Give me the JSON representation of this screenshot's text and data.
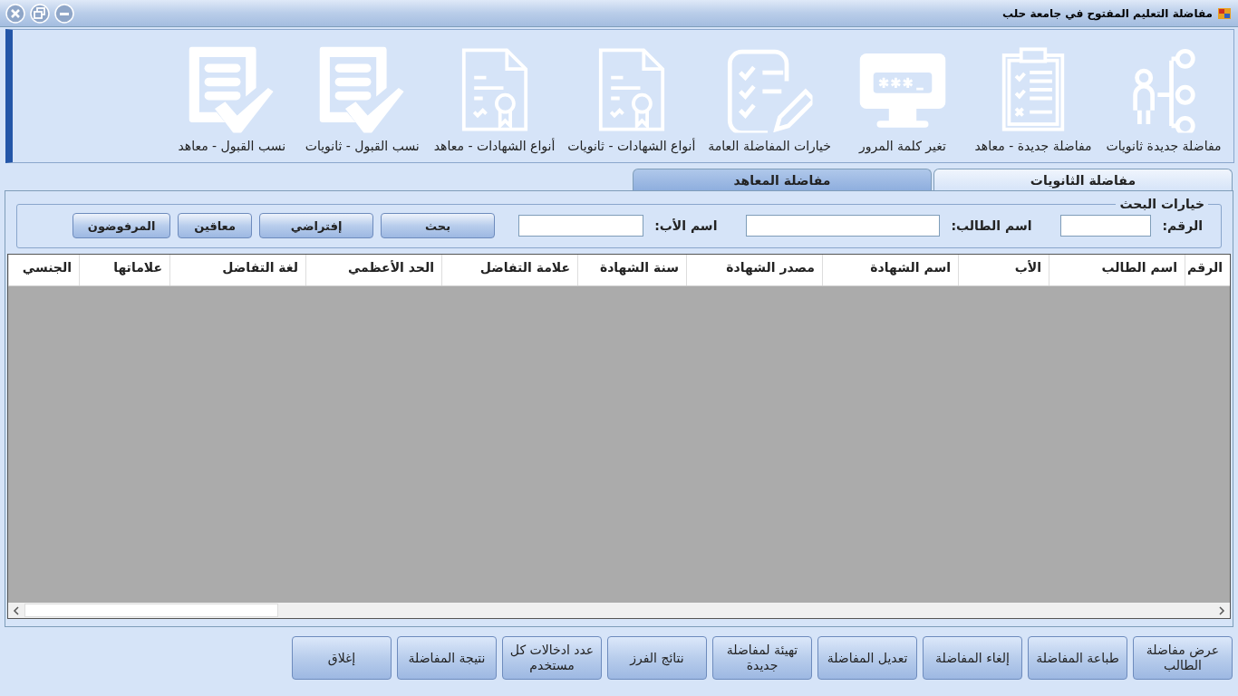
{
  "window": {
    "title": "مفاضلة التعليم المفتوح في جامعة حلب"
  },
  "toolbar": {
    "items": [
      {
        "label": "مفاضلة جديدة ثانويات"
      },
      {
        "label": "مفاضلة جديدة - معاهد"
      },
      {
        "label": "تغير كلمة المرور"
      },
      {
        "label": "خيارات المفاضلة العامة"
      },
      {
        "label": "أنواع الشهادات - ثانويات"
      },
      {
        "label": "أنواع الشهادات - معاهد"
      },
      {
        "label": "نسب القبول - ثانويات"
      },
      {
        "label": "نسب القبول - معاهد"
      }
    ]
  },
  "tabs": [
    {
      "label": "مفاضلة  الثانويات",
      "selected": true
    },
    {
      "label": "مفاضلة  المعاهد",
      "selected": false
    }
  ],
  "search": {
    "title": "خيارات البحث",
    "fields": [
      {
        "label": "الرقم:"
      },
      {
        "label": "اسم الطالب:"
      },
      {
        "label": "اسم الأب:"
      }
    ],
    "buttons": [
      "بحث",
      "إفتراضي",
      "معاقين",
      "المرفوضون"
    ]
  },
  "table": {
    "columns": [
      "الرقم",
      "اسم الطالب",
      "الأب",
      "اسم الشهادة",
      "مصدر الشهادة",
      "سنة الشهادة",
      "علامة التفاضل",
      "الحد الأعظمي",
      "لغة التفاضل",
      "علاماتها",
      "الجنسي"
    ]
  },
  "buttons": [
    "عرض مفاضلة الطالب",
    "طباعة المفاضلة",
    "إلغاء المفاضلة",
    "تعديل المفاضلة",
    "تهيئة لمفاضلة جديدة",
    "نتائج الفرز",
    "عدد ادخالات كل مستخدم",
    "نتيجة المفاضلة",
    "إغلاق"
  ]
}
